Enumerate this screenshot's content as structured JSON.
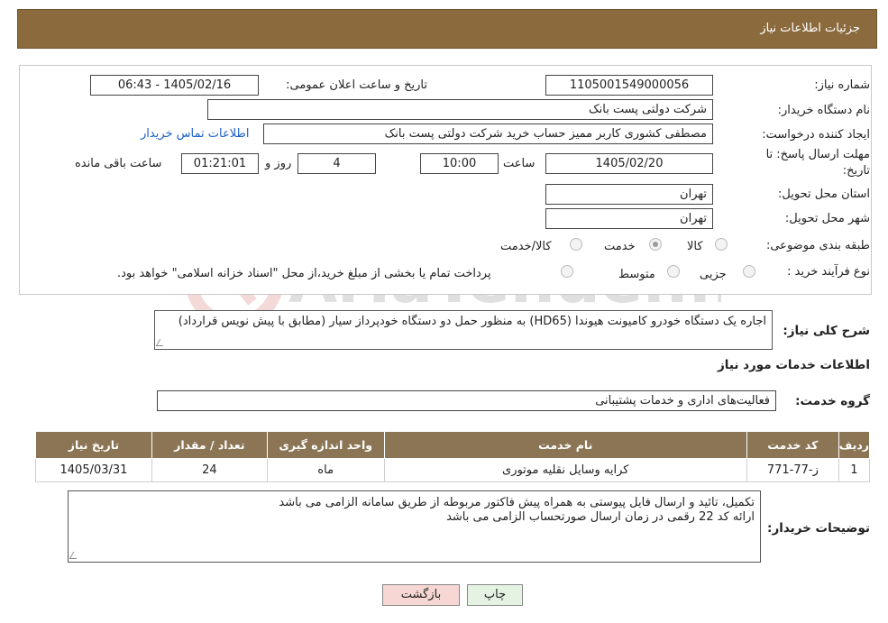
{
  "header": {
    "title": "جزئیات اطلاعات نیاز"
  },
  "form": {
    "need_number": {
      "label": "شماره نیاز:",
      "value": "1105001549000056"
    },
    "announce_datetime": {
      "label": "تاریخ و ساعت اعلان عمومی:",
      "value": "1405/02/16 - 06:43"
    },
    "buyer_org": {
      "label": "نام دستگاه خریدار:",
      "value": "شرکت دولتی پست بانک"
    },
    "requester": {
      "label": "ایجاد کننده درخواست:",
      "value": "مصطفی کشوری کاربر ممیز حساب خرید شرکت دولتی پست بانک",
      "contact_link": "اطلاعات تماس خریدار"
    },
    "deadline": {
      "label_line1": "مهلت ارسال پاسخ: تا",
      "label_line2": "تاریخ:",
      "date": "1405/02/20",
      "time_label": "ساعت",
      "time": "10:00",
      "days": "4",
      "days_label": "روز و",
      "remaining_time": "01:21:01",
      "remaining_label": "ساعت باقی مانده"
    },
    "province": {
      "label": "استان محل تحویل:",
      "value": "تهران"
    },
    "city": {
      "label": "شهر محل تحویل:",
      "value": "تهران"
    },
    "category": {
      "label": "طبقه بندی موضوعی:",
      "options": [
        "کالا",
        "خدمت",
        "کالا/خدمت"
      ],
      "selected": "خدمت"
    },
    "purchase_process": {
      "label": "نوع فرآیند خرید :",
      "options": [
        "جزیی",
        "متوسط"
      ],
      "note": "پرداخت تمام یا بخشی از مبلغ خرید،از محل \"اسناد خزانه اسلامی\" خواهد بود."
    }
  },
  "description": {
    "label": "شرح کلی نیاز:",
    "text": "اجاره یک دستگاه خودرو کامیونت هیوندا (HD65) به منظور حمل دو دستگاه خودپرداز سیار (مطابق با پیش نویس قرارداد)"
  },
  "services_section": {
    "title": "اطلاعات خدمات مورد نیاز",
    "group_label": "گروه خدمت:",
    "group_value": "فعالیت‌های اداری و خدمات پشتیبانی"
  },
  "table": {
    "headers": [
      "ردیف",
      "کد خدمت",
      "نام خدمت",
      "واحد اندازه گیری",
      "تعداد / مقدار",
      "تاریخ نیاز"
    ],
    "rows": [
      [
        "1",
        "ز-77-771",
        "کرایه وسایل نقلیه موتوری",
        "ماه",
        "24",
        "1405/03/31"
      ]
    ]
  },
  "buyer_notes": {
    "label": "توضیحات خریدار:",
    "line1": "تکمیل، تائید و ارسال فایل پیوستی به همراه پیش فاکتور مربوطه از طریق سامانه الزامی می باشد",
    "line2": "ارائه کد 22 رقمی در زمان ارسال صورتحساب الزامی می باشد"
  },
  "buttons": {
    "print": "چاپ",
    "back": "بازگشت"
  },
  "watermark": {
    "text": "AriaTender.neT"
  },
  "colors": {
    "header_bg": "#8b6b3e",
    "table_header_bg": "#8b7555",
    "link": "#1c5fc7",
    "back_btn": "#f6d7d3",
    "print_btn": "#e4f3e2"
  }
}
